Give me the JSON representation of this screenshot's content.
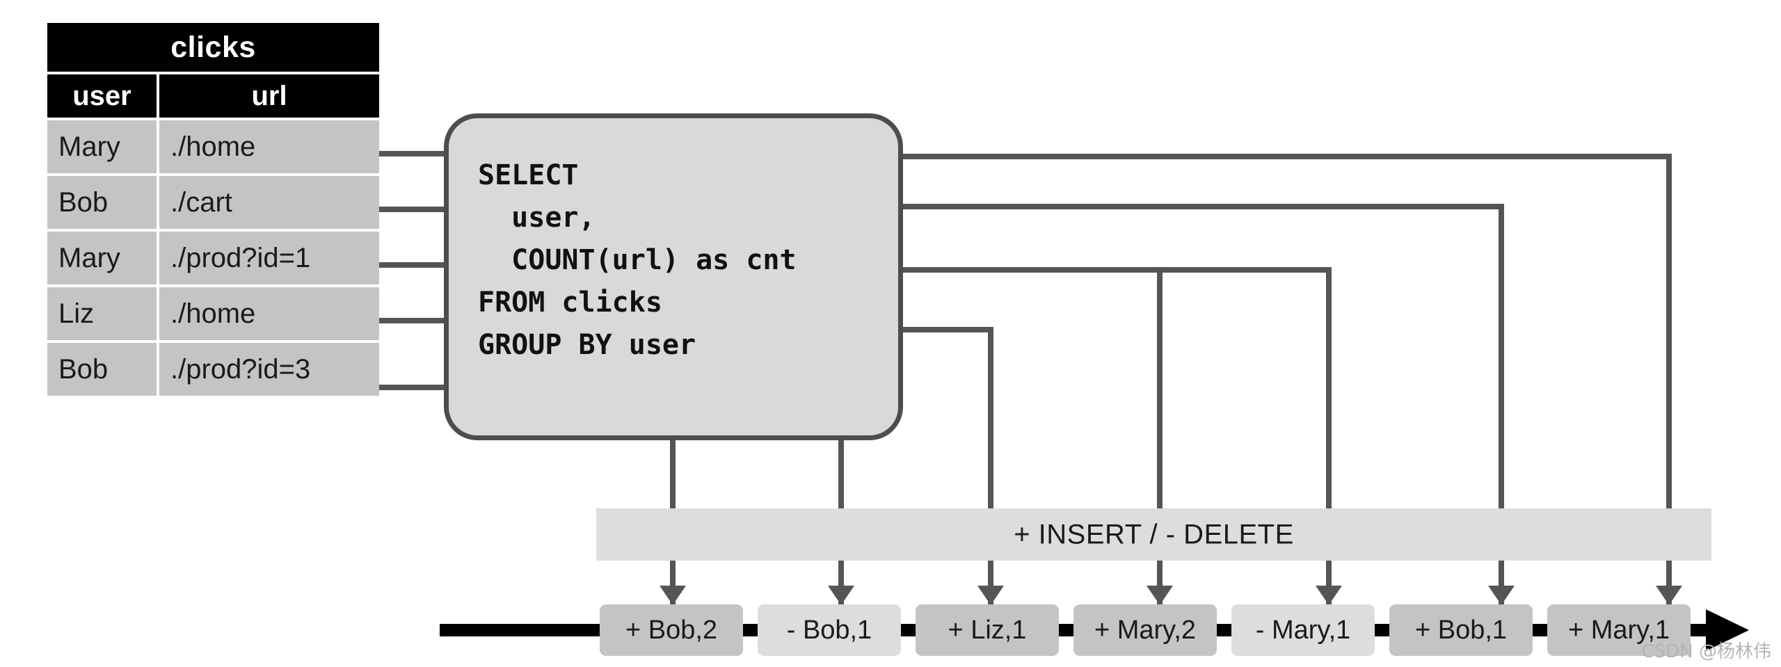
{
  "source_table": {
    "title": "clicks",
    "columns": [
      "user",
      "url"
    ],
    "rows": [
      [
        "Mary",
        "./home"
      ],
      [
        "Bob",
        "./cart"
      ],
      [
        "Mary",
        "./prod?id=1"
      ],
      [
        "Liz",
        "./home"
      ],
      [
        "Bob",
        "./prod?id=3"
      ]
    ]
  },
  "query": {
    "sql": "SELECT\n  user,\n  COUNT(url) as cnt\nFROM clicks\nGROUP BY user"
  },
  "changelog_band": {
    "label": "+ INSERT / - DELETE"
  },
  "stream": {
    "events": [
      {
        "label": "+ Bob,2",
        "op": "+",
        "user": "Bob",
        "cnt": "2",
        "tone": "dark"
      },
      {
        "label": "- Bob,1",
        "op": "-",
        "user": "Bob",
        "cnt": "1",
        "tone": "light"
      },
      {
        "label": "+ Liz,1",
        "op": "+",
        "user": "Liz",
        "cnt": "1",
        "tone": "dark"
      },
      {
        "label": "+ Mary,2",
        "op": "+",
        "user": "Mary",
        "cnt": "2",
        "tone": "dark"
      },
      {
        "label": "- Mary,1",
        "op": "-",
        "user": "Mary",
        "cnt": "1",
        "tone": "light"
      },
      {
        "label": "+ Bob,1",
        "op": "+",
        "user": "Bob",
        "cnt": "1",
        "tone": "dark"
      },
      {
        "label": "+ Mary,1",
        "op": "+",
        "user": "Mary",
        "cnt": "1",
        "tone": "dark"
      }
    ]
  },
  "colors": {
    "header_bg": "#000000",
    "cell_bg": "#c4c4c4",
    "box_bg": "#d9d9d9",
    "box_border": "#4d4d4d",
    "wire": "#555555",
    "band_bg": "#dddddd",
    "event_dark": "#c4c4c4",
    "event_light": "#dddddd",
    "stream_line": "#000000"
  },
  "watermark": {
    "text": "CSDN @杨林伟"
  }
}
